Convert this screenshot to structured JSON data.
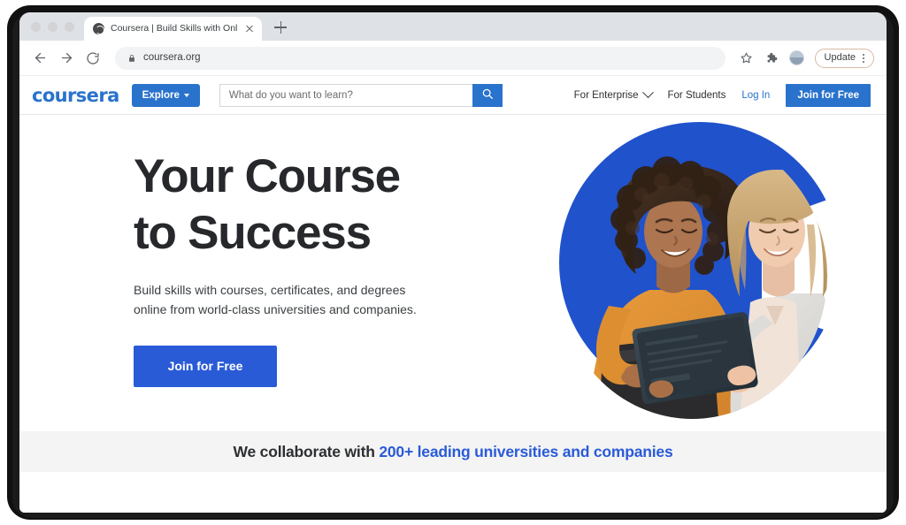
{
  "browser": {
    "tab": {
      "title": "Coursera | Build Skills with Onl",
      "favicon_icon": "globe-icon",
      "close_icon": "close-icon"
    },
    "new_tab_icon": "plus-icon",
    "back_icon": "arrow-left-icon",
    "forward_icon": "arrow-right-icon",
    "reload_icon": "reload-icon",
    "lock_icon": "lock-icon",
    "url": "coursera.org",
    "bookmark_icon": "star-icon",
    "extensions_icon": "puzzle-piece-icon",
    "avatar_icon": "profile-avatar",
    "update_label": "Update",
    "menu_icon": "kebab-menu-icon",
    "traffic_lights": [
      "close",
      "minimize",
      "maximize"
    ]
  },
  "site": {
    "logo": "coursera",
    "explore_label": "Explore",
    "explore_caret_icon": "chevron-down-icon",
    "search": {
      "placeholder": "What do you want to learn?",
      "value": "",
      "button_icon": "search-icon"
    },
    "nav": {
      "enterprise": "For Enterprise",
      "enterprise_caret_icon": "chevron-down-icon",
      "students": "For Students",
      "login": "Log In",
      "join": "Join for Free"
    }
  },
  "hero": {
    "title_line1": "Your Course",
    "title_line2": "to Success",
    "subtitle_line1": "Build skills with courses, certificates, and degrees online",
    "subtitle_line2": "from world-class universities and companies.",
    "cta_label": "Join for Free",
    "artwork": "two-women-with-tablet-photo-on-blue-c-mark"
  },
  "collaborate": {
    "prefix": "We collaborate with ",
    "highlight": "200+ leading universities and companies"
  },
  "colors": {
    "brand_blue": "#2a73cc",
    "cta_blue": "#2a5bd7",
    "mark_blue": "#2052cc",
    "band_grey": "#f4f4f4",
    "text_dark": "#26282b"
  }
}
